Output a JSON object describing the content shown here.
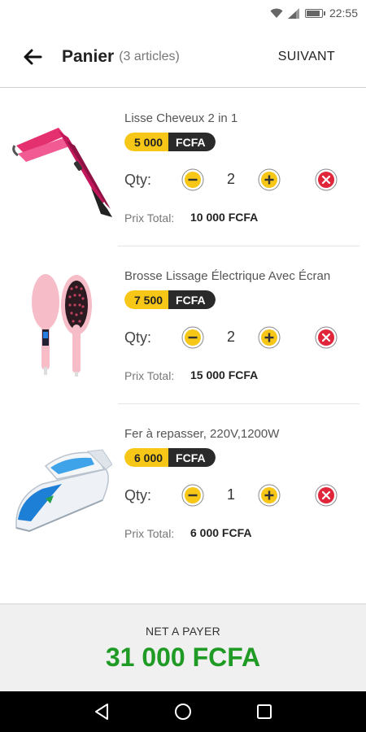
{
  "status_bar": {
    "time": "22:55"
  },
  "header": {
    "title": "Panier",
    "subtitle": "(3 articles)",
    "next_label": "SUIVANT"
  },
  "cart": {
    "qty_label": "Qty:",
    "total_label": "Prix Total:",
    "items": [
      {
        "name": "Lisse Cheveux 2 in 1",
        "price": "5 000",
        "currency": "FCFA",
        "qty": "2",
        "total": "10 000 FCFA",
        "image": "hair-straightener-image"
      },
      {
        "name": "Brosse Lissage Électrique Avec Écran",
        "price": "7 500",
        "currency": "FCFA",
        "qty": "2",
        "total": "15 000 FCFA",
        "image": "straightening-brush-image"
      },
      {
        "name": "Fer à repasser, 220V,1200W",
        "price": "6 000",
        "currency": "FCFA",
        "qty": "1",
        "total": "6 000 FCFA",
        "image": "iron-image"
      }
    ]
  },
  "footer": {
    "net_label": "NET A PAYER",
    "net_value": "31 000 FCFA"
  },
  "colors": {
    "accent_yellow": "#f7c718",
    "badge_dark": "#2a2a2a",
    "remove_red": "#e0263a",
    "total_green": "#1f9a24"
  }
}
